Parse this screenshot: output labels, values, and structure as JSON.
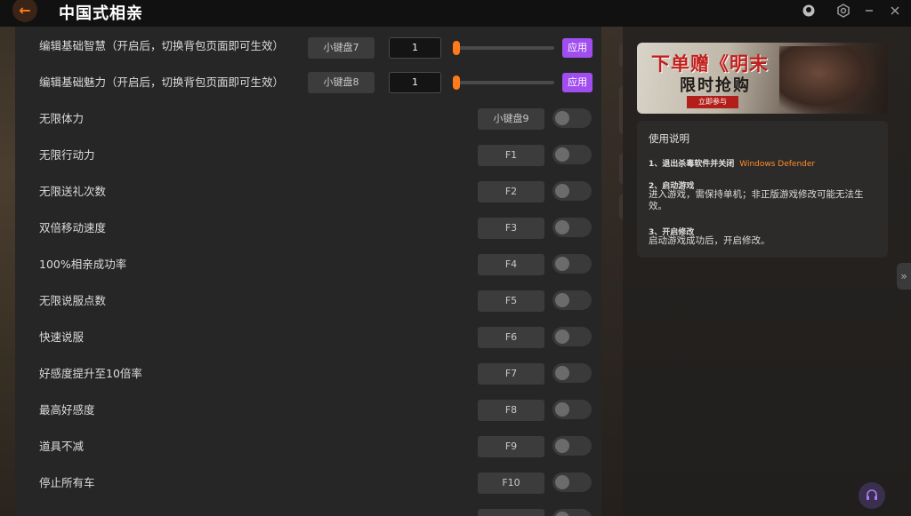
{
  "app": {
    "title": "中国式相亲"
  },
  "titlebar": {
    "back_icon": "←",
    "controls": [
      "user-icon",
      "settings-icon",
      "minimize-icon",
      "close-icon"
    ]
  },
  "edit_rows": [
    {
      "label": "编辑基础智慧（开启后，切换背包页面即可生效）",
      "key": "小键盘7",
      "value": "1",
      "apply": "应用",
      "slider_level": 0
    },
    {
      "label": "编辑基础魅力（开启后，切换背包页面即可生效）",
      "key": "小键盘8",
      "value": "1",
      "apply": "应用",
      "slider_level": 0
    }
  ],
  "toggle_rows": [
    {
      "label": "无限体力",
      "key": "小键盘9",
      "enabled": false
    },
    {
      "label": "无限行动力",
      "key": "F1",
      "enabled": false
    },
    {
      "label": "无限送礼次数",
      "key": "F2",
      "enabled": false
    },
    {
      "label": "双倍移动速度",
      "key": "F3",
      "enabled": false
    },
    {
      "label": "100%相亲成功率",
      "key": "F4",
      "enabled": false
    },
    {
      "label": "无限说服点数",
      "key": "F5",
      "enabled": false
    },
    {
      "label": "快速说服",
      "key": "F6",
      "enabled": false
    },
    {
      "label": "好感度提升至10倍率",
      "key": "F7",
      "enabled": false
    },
    {
      "label": "最高好感度",
      "key": "F8",
      "enabled": false
    },
    {
      "label": "道具不减",
      "key": "F9",
      "enabled": false
    },
    {
      "label": "停止所有车",
      "key": "F10",
      "enabled": false
    },
    {
      "label": "",
      "key": "",
      "enabled": false
    }
  ],
  "banner": {
    "line1": "下单赠《明末",
    "line2": "限时抢购",
    "button": "立即参与"
  },
  "help": {
    "title": "使用说明",
    "step1": "1、退出杀毒软件并关闭",
    "step1_link": "Windows Defender",
    "step2": "2、启动游戏",
    "step2_desc": "进入游戏，需保持单机；非正版游戏修改可能无法生效。",
    "step3": "3、开启修改",
    "step3_desc": "启动游戏成功后，开启修改。"
  },
  "colors": {
    "accent_orange": "#ff7a1a",
    "apply_purple": "#a14ef0",
    "panel_bg": "#262626"
  }
}
